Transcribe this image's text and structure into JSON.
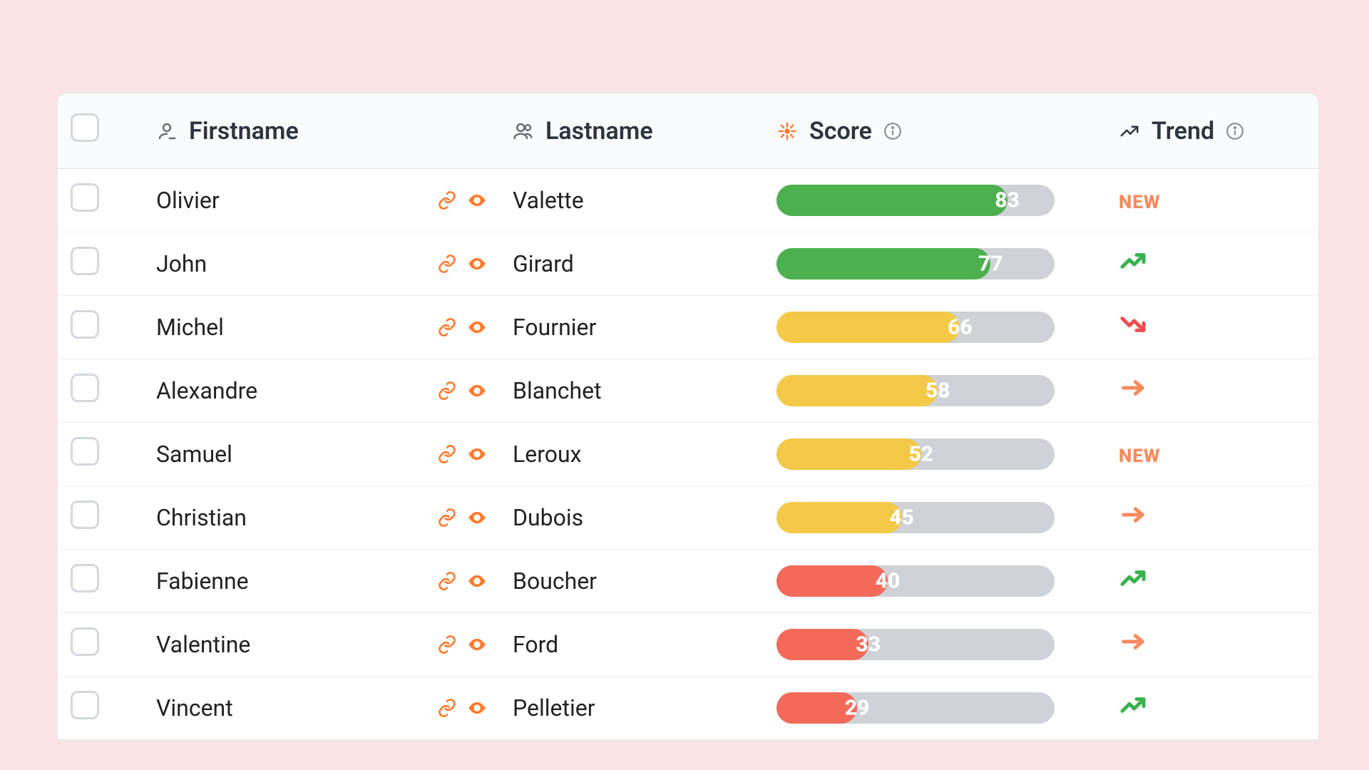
{
  "columns": {
    "firstname": "Firstname",
    "lastname": "Lastname",
    "score": "Score",
    "trend": "Trend"
  },
  "labels": {
    "new": "NEW"
  },
  "colors": {
    "accent": "#ff7a2f",
    "green": "#4cb04e",
    "yellow": "#f5c948",
    "red": "#f36a5b",
    "bar_bg": "#cfd2d6",
    "trend_up": "#37b24d",
    "trend_down": "#ef4d52",
    "trend_flat": "#f78a5e"
  },
  "score_thresholds": {
    "green_min": 70,
    "yellow_min": 45
  },
  "rows": [
    {
      "firstname": "Olivier",
      "lastname": "Valette",
      "score": 83,
      "trend": "new"
    },
    {
      "firstname": "John",
      "lastname": "Girard",
      "score": 77,
      "trend": "up"
    },
    {
      "firstname": "Michel",
      "lastname": "Fournier",
      "score": 66,
      "trend": "down"
    },
    {
      "firstname": "Alexandre",
      "lastname": "Blanchet",
      "score": 58,
      "trend": "flat"
    },
    {
      "firstname": "Samuel",
      "lastname": "Leroux",
      "score": 52,
      "trend": "new"
    },
    {
      "firstname": "Christian",
      "lastname": "Dubois",
      "score": 45,
      "trend": "flat"
    },
    {
      "firstname": "Fabienne",
      "lastname": "Boucher",
      "score": 40,
      "trend": "up"
    },
    {
      "firstname": "Valentine",
      "lastname": "Ford",
      "score": 33,
      "trend": "flat"
    },
    {
      "firstname": "Vincent",
      "lastname": "Pelletier",
      "score": 29,
      "trend": "up"
    }
  ]
}
